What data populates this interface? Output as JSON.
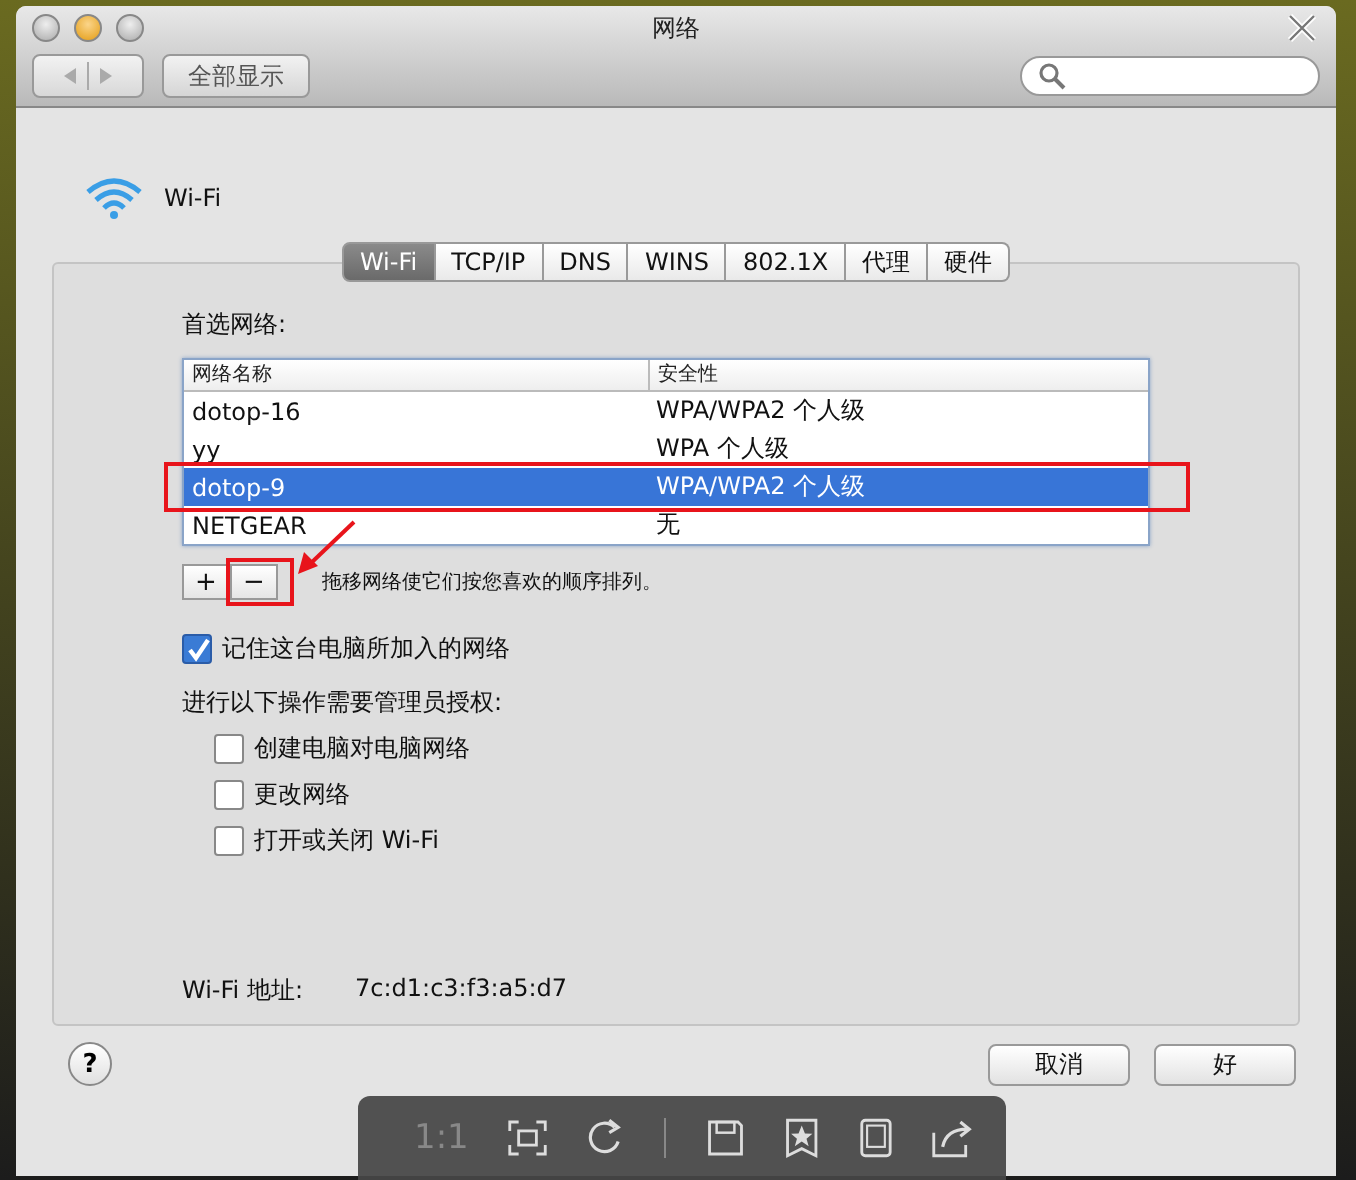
{
  "window": {
    "title": "网络"
  },
  "toolbar": {
    "show_all": "全部显示"
  },
  "service": {
    "name": "Wi-Fi"
  },
  "tabs": [
    {
      "label": "Wi-Fi",
      "selected": true
    },
    {
      "label": "TCP/IP",
      "selected": false
    },
    {
      "label": "DNS",
      "selected": false
    },
    {
      "label": "WINS",
      "selected": false
    },
    {
      "label": "802.1X",
      "selected": false
    },
    {
      "label": "代理",
      "selected": false
    },
    {
      "label": "硬件",
      "selected": false
    }
  ],
  "preferred_label": "首选网络:",
  "table": {
    "columns": [
      "网络名称",
      "安全性"
    ],
    "rows": [
      {
        "name": "dotop-16",
        "security": "WPA/WPA2 个人级",
        "selected": false
      },
      {
        "name": "yy",
        "security": "WPA 个人级",
        "selected": false
      },
      {
        "name": "dotop-9",
        "security": "WPA/WPA2 个人级",
        "selected": true
      },
      {
        "name": "NETGEAR",
        "security": "无",
        "selected": false
      }
    ]
  },
  "list_buttons": [
    "+",
    "−"
  ],
  "hint": "拖移网络使它们按您喜欢的顺序排列。",
  "remember": {
    "label": "记住这台电脑所加入的网络",
    "checked": true
  },
  "admin_label": "进行以下操作需要管理员授权:",
  "admin_options": [
    {
      "label": "创建电脑对电脑网络",
      "checked": false
    },
    {
      "label": "更改网络",
      "checked": false
    },
    {
      "label": "打开或关闭 Wi-Fi",
      "checked": false
    }
  ],
  "address": {
    "label": "Wi-Fi 地址:",
    "value": "7c:d1:c3:f3:a5:d7"
  },
  "help": "?",
  "buttons": [
    "取消",
    "好"
  ],
  "viewer_toolbar": {
    "zoom": "1:1"
  }
}
